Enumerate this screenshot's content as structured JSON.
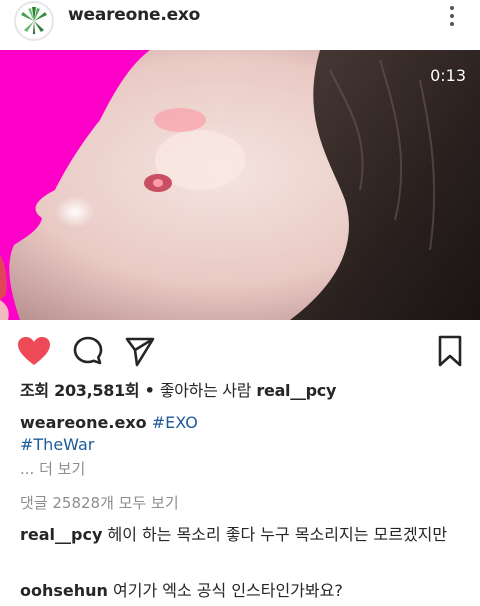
{
  "post": {
    "username": "weareone.exo",
    "video_time": "0:13"
  },
  "stats": {
    "views_label": "조회",
    "views_count": "203,581회",
    "bullet": "•",
    "liked_by_label": "좋아하는 사람",
    "liked_by_user": "real__pcy"
  },
  "caption": {
    "username": "weareone.exo",
    "hashtag1": "#EXO",
    "hashtag2": "#TheWar",
    "more_label": "... 더 보기"
  },
  "comments": {
    "view_all_label": "댓글 25828개 모두 보기",
    "items": [
      {
        "user": "real__pcy",
        "text": "헤이 하는 목소리 좋다 누구 목소리지는 모르겠지만"
      },
      {
        "user": "oohsehun",
        "text": "여기가 엑소 공식 인스타인가봐요?"
      }
    ]
  },
  "colors": {
    "heart": "#ed4956",
    "hashtag": "#1f5a9a",
    "muted": "#8e8e8e"
  },
  "icons": [
    "leaf-logo-icon",
    "more-vertical-icon",
    "heart-icon",
    "comment-icon",
    "share-icon",
    "bookmark-icon"
  ]
}
